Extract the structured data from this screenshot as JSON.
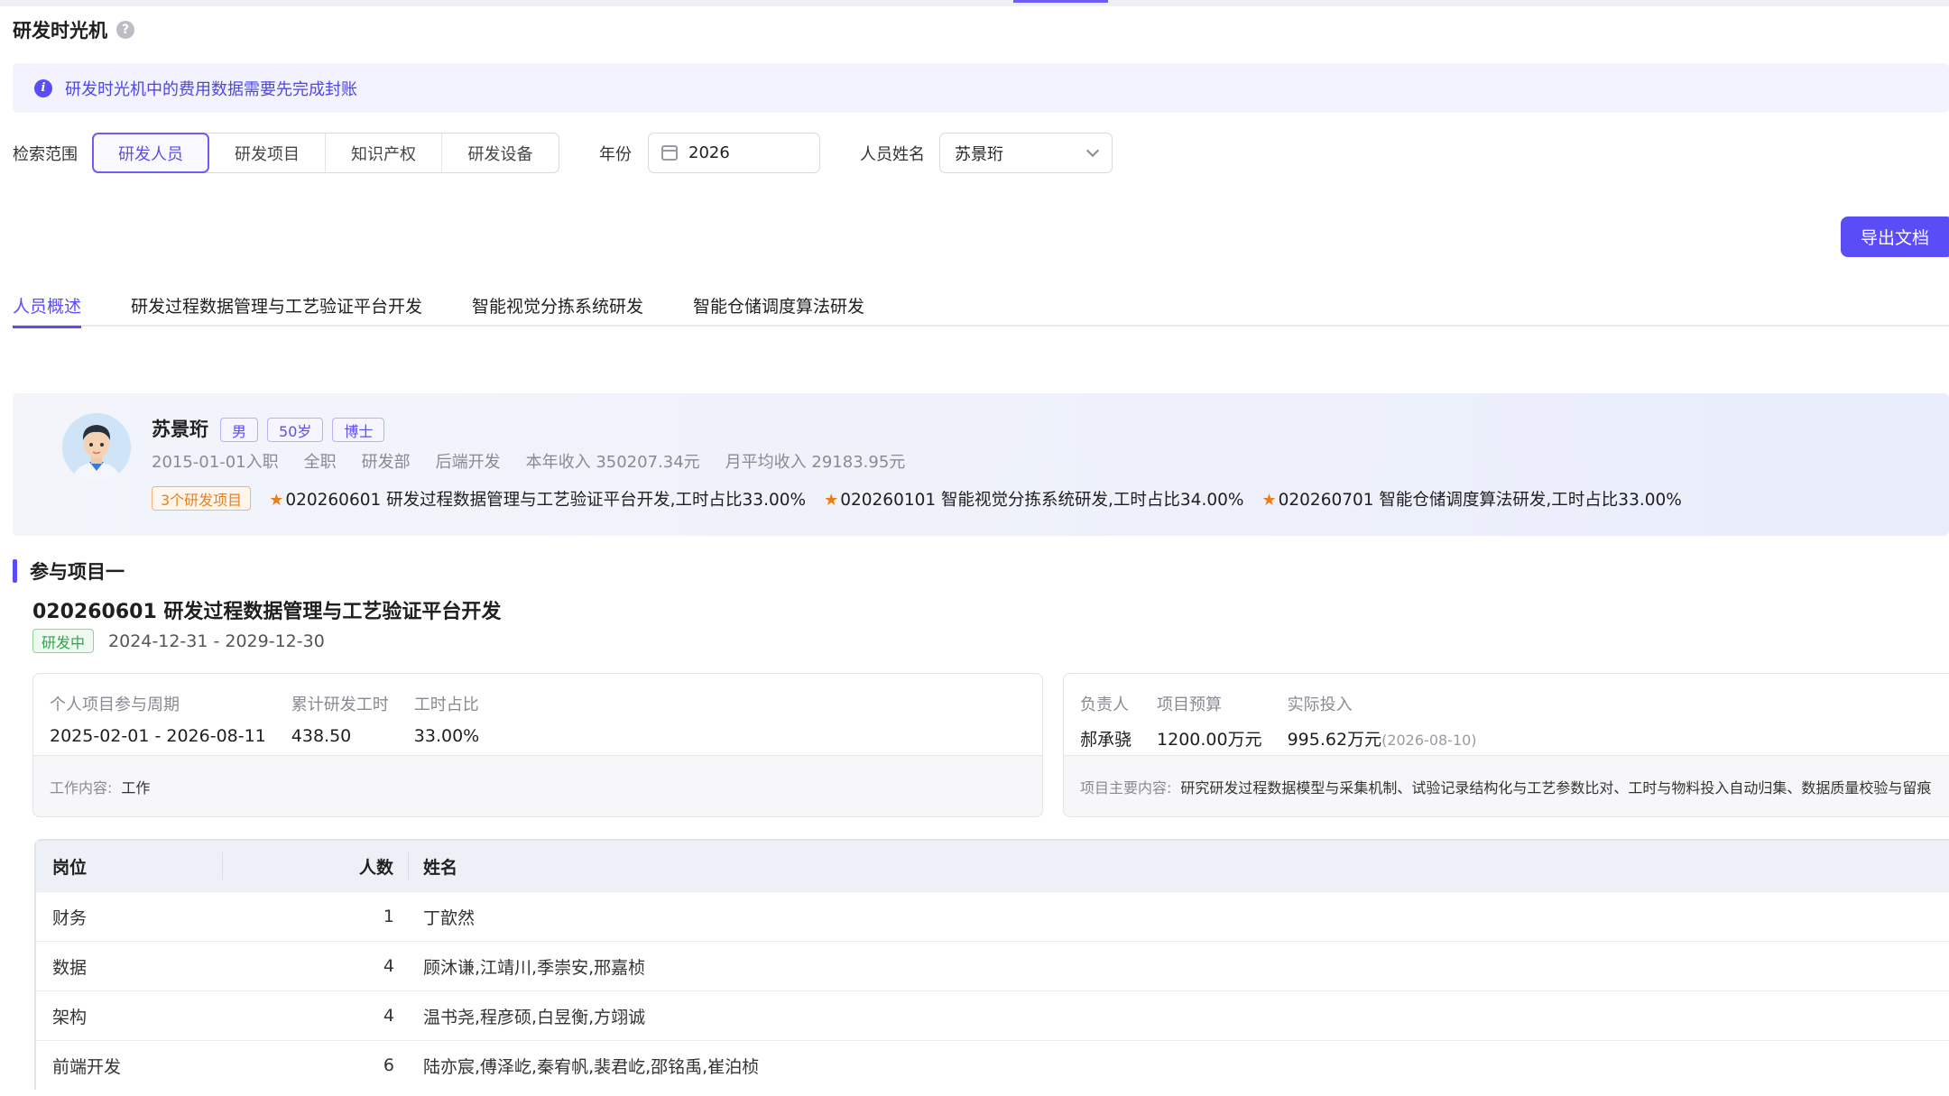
{
  "page": {
    "title": "研发时光机"
  },
  "notice": {
    "text": "研发时光机中的费用数据需要先完成封账"
  },
  "filters": {
    "scope_label": "检索范围",
    "scope_options": [
      "研发人员",
      "研发项目",
      "知识产权",
      "研发设备"
    ],
    "scope_selected": "研发人员",
    "year_label": "年份",
    "year_value": "2026",
    "name_label": "人员姓名",
    "name_value": "苏景珩"
  },
  "actions": {
    "export_label": "导出文档"
  },
  "tabs": [
    "人员概述",
    "研发过程数据管理与工艺验证平台开发",
    "智能视觉分拣系统研发",
    "智能仓储调度算法研发"
  ],
  "profile": {
    "name": "苏景珩",
    "tags": [
      "男",
      "50岁",
      "博士"
    ],
    "meta": [
      "2015-01-01入职",
      "全职",
      "研发部",
      "后端开发",
      "本年收入 350207.34元",
      "月平均收入 29183.95元"
    ],
    "projects_count_label": "3个研发项目",
    "projects": [
      "020260601 研发过程数据管理与工艺验证平台开发,工时占比33.00%",
      "020260101 智能视觉分拣系统研发,工时占比34.00%",
      "020260701 智能仓储调度算法研发,工时占比33.00%"
    ]
  },
  "section": {
    "heading": "参与项目一",
    "project_title": "020260601 研发过程数据管理与工艺验证平台开发",
    "status": "研发中",
    "date_range": "2024-12-31 - 2029-12-30"
  },
  "personal_card": {
    "stats": [
      {
        "label": "个人项目参与周期",
        "value": "2025-02-01 - 2026-08-11"
      },
      {
        "label": "累计研发工时",
        "value": "438.50"
      },
      {
        "label": "工时占比",
        "value": "33.00%"
      }
    ],
    "work_label": "工作内容:",
    "work_value": "工作"
  },
  "project_card": {
    "stats": [
      {
        "label": "负责人",
        "value": "郝承骁"
      },
      {
        "label": "项目预算",
        "value": "1200.00万元"
      },
      {
        "label": "实际投入",
        "value": "995.62万元",
        "sub": "(2026-08-10)"
      }
    ],
    "content_label": "项目主要内容:",
    "content_value": "研究研发过程数据模型与采集机制、试验记录结构化与工艺参数比对、工时与物料投入自动归集、数据质量校验与留痕"
  },
  "table": {
    "headers": [
      "岗位",
      "人数",
      "姓名"
    ],
    "rows": [
      [
        "财务",
        "1",
        "丁歆然"
      ],
      [
        "数据",
        "4",
        "顾沐谦,江靖川,季崇安,邢嘉桢"
      ],
      [
        "架构",
        "4",
        "温书尧,程彦硕,白昱衡,方翊诚"
      ],
      [
        "前端开发",
        "6",
        "陆亦宸,傅泽屹,秦宥帆,裴君屹,邵铭禹,崔泊桢"
      ]
    ]
  }
}
